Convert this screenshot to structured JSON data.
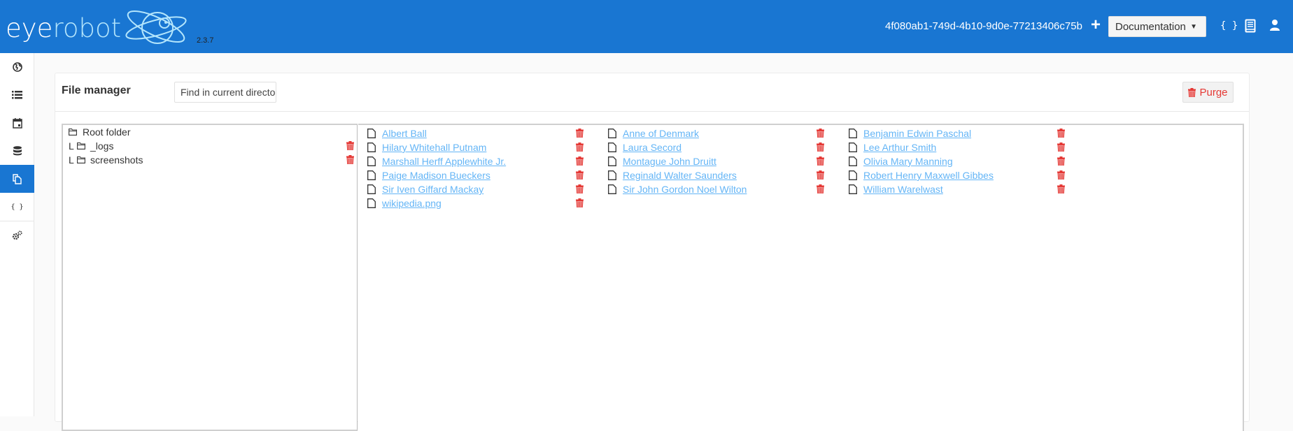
{
  "header": {
    "logo_part1": "eye",
    "logo_part2": "robot",
    "version": "2.3.7",
    "run_id": "4f080ab1-749d-4b10-9d0e-77213406c75b",
    "add_label": "+",
    "doc_select": {
      "selected": "Documentation",
      "caret": "▼"
    },
    "icons": [
      "braces-icon",
      "book-icon",
      "user-icon"
    ],
    "braces_text": "{ }",
    "brand_color": "#1976d2"
  },
  "sidebar": {
    "items": [
      {
        "name": "globe",
        "active": false
      },
      {
        "name": "list",
        "active": false
      },
      {
        "name": "calendar",
        "active": false
      },
      {
        "name": "database",
        "active": false
      },
      {
        "name": "files",
        "active": true
      },
      {
        "name": "braces",
        "active": false,
        "text": "{ }"
      },
      {
        "name": "settings",
        "active": false
      }
    ]
  },
  "file_manager": {
    "title": "File manager",
    "search": {
      "placeholder": "Find in current directory",
      "value": ""
    },
    "purge_label": "Purge",
    "tree": {
      "root": "Root folder",
      "branch_glyph": "L",
      "folders": [
        "_logs",
        "screenshots"
      ]
    },
    "files": {
      "columns": [
        [
          "Albert Ball",
          "Hilary Whitehall Putnam",
          "Marshall Herff Applewhite Jr.",
          "Paige Madison Bueckers",
          "Sir Iven Giffard Mackay",
          "wikipedia.png"
        ],
        [
          "Anne of Denmark",
          "Laura Secord",
          "Montague John Druitt",
          "Reginald Walter Saunders",
          "Sir John Gordon Noel Wilton"
        ],
        [
          "Benjamin Edwin Paschal",
          "Lee Arthur Smith",
          "Olivia Mary Manning",
          "Robert Henry Maxwell Gibbes",
          "William Warelwast"
        ]
      ]
    },
    "colors": {
      "link": "#64b5f6",
      "delete": "#e53935"
    }
  }
}
